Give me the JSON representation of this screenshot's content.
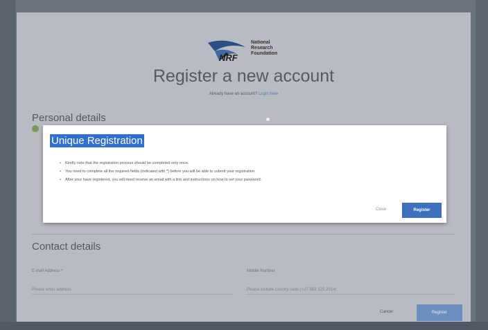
{
  "header": {
    "logo_text": "National Research Foundation",
    "logo_abbrev": "NRF",
    "title": "Register a new account",
    "subtitle": "Already have an account?",
    "login_link": "Login here"
  },
  "sections": {
    "personal_title": "Personal details",
    "contact_title": "Contact details"
  },
  "contact_fields": {
    "email_label": "E-mail Address *",
    "email_placeholder": "Please enter address",
    "mobile_label": "Mobile Number",
    "mobile_placeholder": "Please include country code (+27 882 123 2014)"
  },
  "footer": {
    "cancel": "Cancel",
    "register": "Register"
  },
  "modal": {
    "title": "Unique Registration",
    "items": [
      "Kindly note that the registration process should be completed only once.",
      "You need to complete all the required fields (indicated with *) before you will be able to submit your registration.",
      "After your have registered, you will need receive an email with a link and instructions on how to set your password."
    ],
    "close": "Close",
    "register": "Register"
  },
  "colors": {
    "modal_title_highlight": "#2f6fd0",
    "primary_button": "#3c6fbe",
    "overlay_page": "#b8bcc2"
  }
}
